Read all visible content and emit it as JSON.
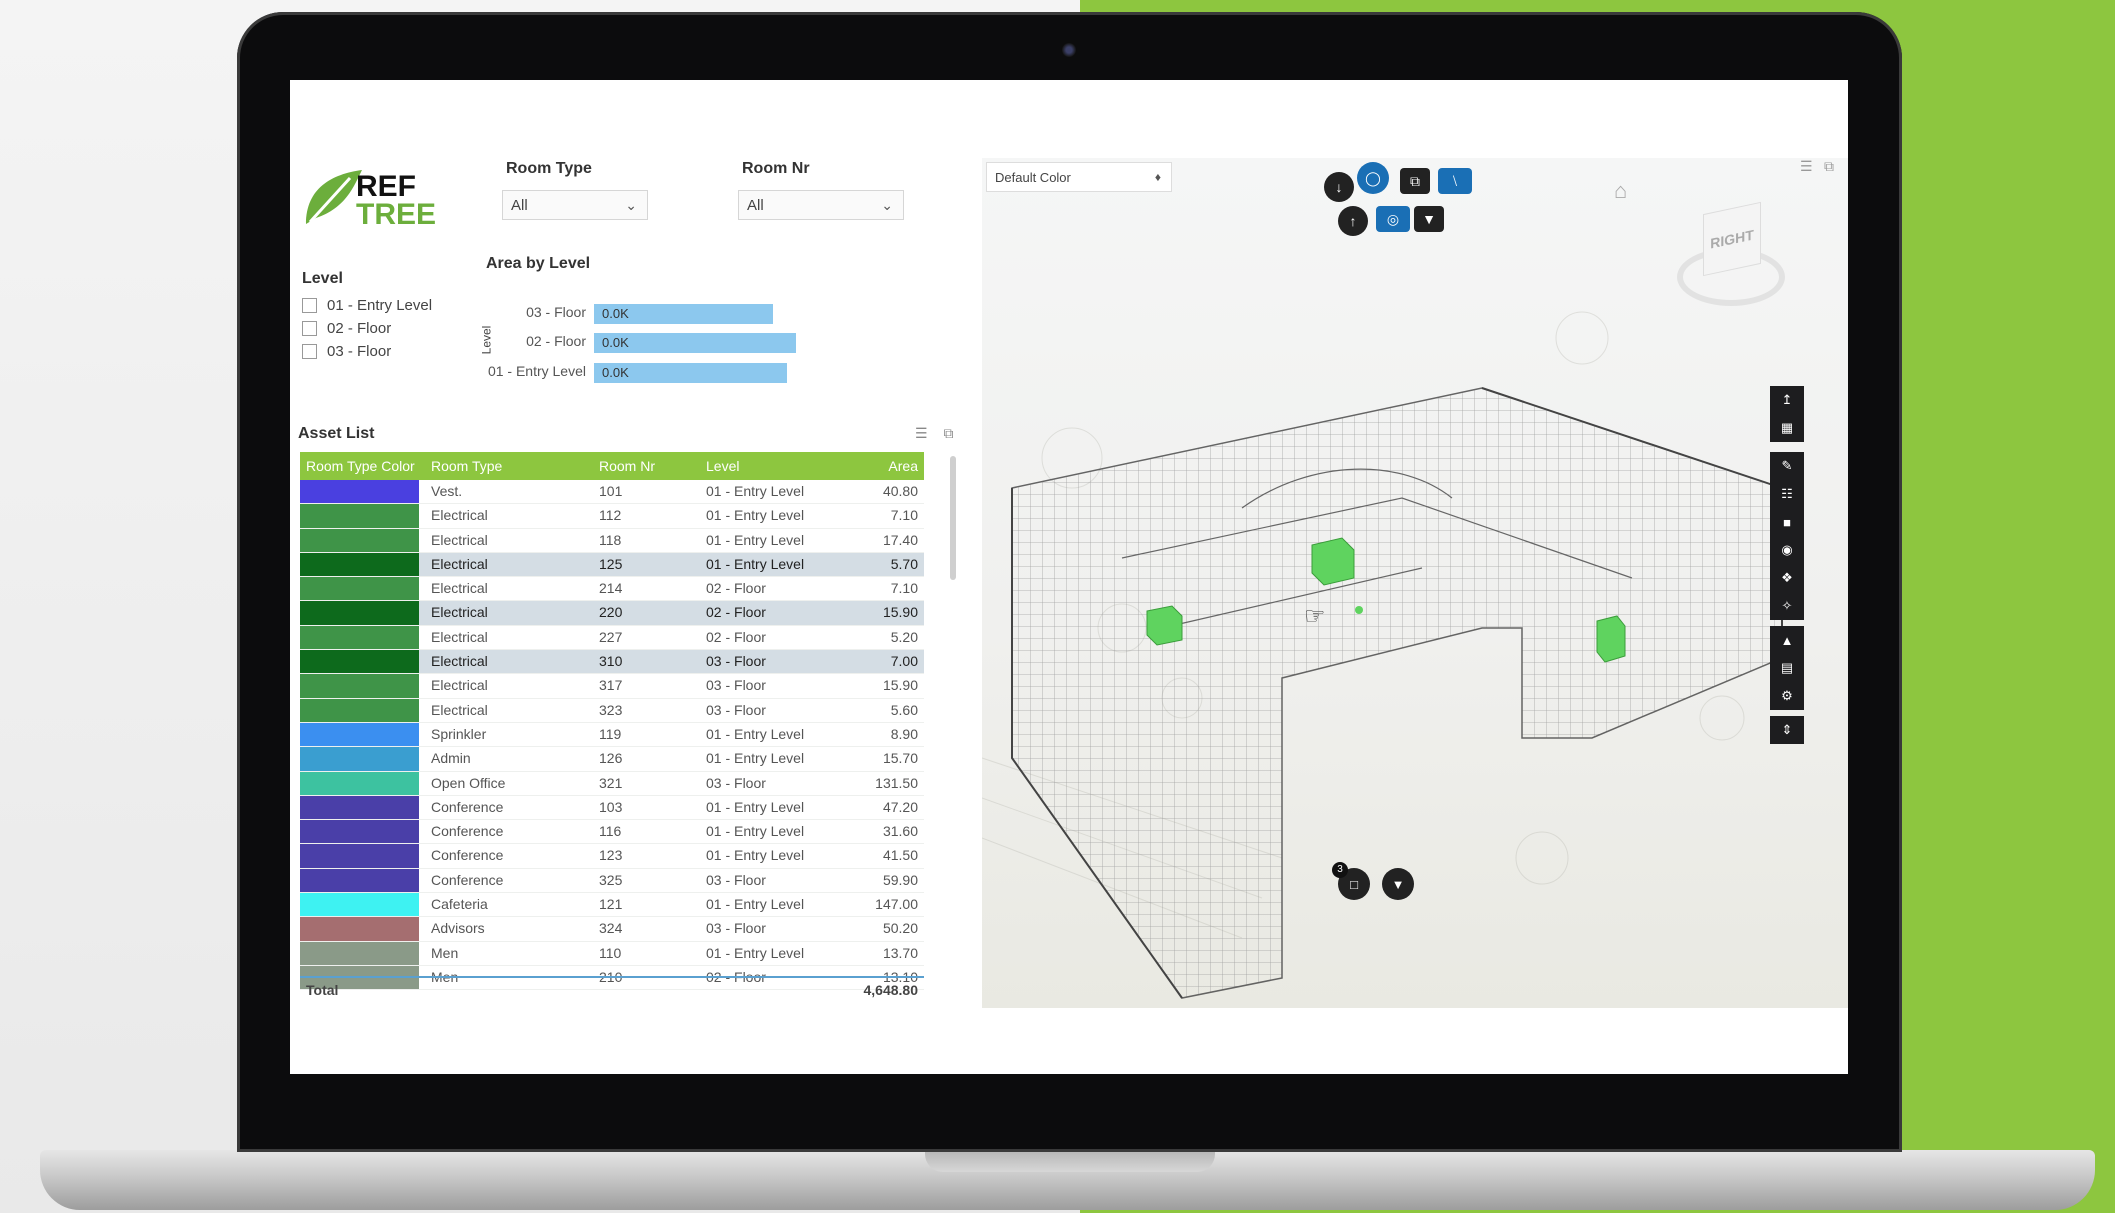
{
  "logo": {
    "line1": "REF",
    "line2": "TREE"
  },
  "slicers": {
    "room_type": {
      "label": "Room Type",
      "value": "All"
    },
    "room_nr": {
      "label": "Room Nr",
      "value": "All"
    }
  },
  "level_slicer": {
    "title": "Level",
    "items": [
      "01 - Entry Level",
      "02 - Floor",
      "03 - Floor"
    ]
  },
  "area_by_level": {
    "title": "Area by Level",
    "axis_label": "Level",
    "bars": [
      {
        "label": "03 - Floor",
        "value": "0.0K",
        "fill": 0.78
      },
      {
        "label": "02 - Floor",
        "value": "0.0K",
        "fill": 0.88
      },
      {
        "label": "01 - Entry Level",
        "value": "0.0K",
        "fill": 0.84
      }
    ]
  },
  "asset_list": {
    "title": "Asset List",
    "columns": [
      "Room Type Color",
      "Room Type",
      "Room Nr",
      "Level",
      "Area"
    ],
    "rows": [
      {
        "color": "#4a40e0",
        "type": "Vest.",
        "nr": "101",
        "level": "01 - Entry Level",
        "area": "40.80",
        "sel": false
      },
      {
        "color": "#3f9448",
        "type": "Electrical",
        "nr": "112",
        "level": "01 - Entry Level",
        "area": "7.10",
        "sel": false
      },
      {
        "color": "#3f9448",
        "type": "Electrical",
        "nr": "118",
        "level": "01 - Entry Level",
        "area": "17.40",
        "sel": false
      },
      {
        "color": "#0d6a1c",
        "type": "Electrical",
        "nr": "125",
        "level": "01 - Entry Level",
        "area": "5.70",
        "sel": true
      },
      {
        "color": "#3f9448",
        "type": "Electrical",
        "nr": "214",
        "level": "02 - Floor",
        "area": "7.10",
        "sel": false
      },
      {
        "color": "#0d6a1c",
        "type": "Electrical",
        "nr": "220",
        "level": "02 - Floor",
        "area": "15.90",
        "sel": true
      },
      {
        "color": "#3f9448",
        "type": "Electrical",
        "nr": "227",
        "level": "02 - Floor",
        "area": "5.20",
        "sel": false
      },
      {
        "color": "#0d6a1c",
        "type": "Electrical",
        "nr": "310",
        "level": "03 - Floor",
        "area": "7.00",
        "sel": true
      },
      {
        "color": "#3f9448",
        "type": "Electrical",
        "nr": "317",
        "level": "03 - Floor",
        "area": "15.90",
        "sel": false
      },
      {
        "color": "#3f9448",
        "type": "Electrical",
        "nr": "323",
        "level": "03 - Floor",
        "area": "5.60",
        "sel": false
      },
      {
        "color": "#3b8ff0",
        "type": "Sprinkler",
        "nr": "119",
        "level": "01 - Entry Level",
        "area": "8.90",
        "sel": false
      },
      {
        "color": "#3a9ed0",
        "type": "Admin",
        "nr": "126",
        "level": "01 - Entry Level",
        "area": "15.70",
        "sel": false
      },
      {
        "color": "#3dc2a0",
        "type": "Open Office",
        "nr": "321",
        "level": "03 - Floor",
        "area": "131.50",
        "sel": false
      },
      {
        "color": "#4a3fa8",
        "type": "Conference",
        "nr": "103",
        "level": "01 - Entry Level",
        "area": "47.20",
        "sel": false
      },
      {
        "color": "#4a3fa8",
        "type": "Conference",
        "nr": "116",
        "level": "01 - Entry Level",
        "area": "31.60",
        "sel": false
      },
      {
        "color": "#4a3fa8",
        "type": "Conference",
        "nr": "123",
        "level": "01 - Entry Level",
        "area": "41.50",
        "sel": false
      },
      {
        "color": "#4a3fa8",
        "type": "Conference",
        "nr": "325",
        "level": "03 - Floor",
        "area": "59.90",
        "sel": false
      },
      {
        "color": "#3ef2f2",
        "type": "Cafeteria",
        "nr": "121",
        "level": "01 - Entry Level",
        "area": "147.00",
        "sel": false
      },
      {
        "color": "#a56e70",
        "type": "Advisors",
        "nr": "324",
        "level": "03 - Floor",
        "area": "50.20",
        "sel": false
      },
      {
        "color": "#8a9a88",
        "type": "Men",
        "nr": "110",
        "level": "01 - Entry Level",
        "area": "13.70",
        "sel": false
      },
      {
        "color": "#8a9a88",
        "type": "Men",
        "nr": "210",
        "level": "02 - Floor",
        "area": "13.10",
        "sel": false
      }
    ],
    "total_label": "Total",
    "total_value": "4,648.80"
  },
  "viewer": {
    "color_mode": "Default Color",
    "cube_label": "RIGHT",
    "badge": "3"
  }
}
